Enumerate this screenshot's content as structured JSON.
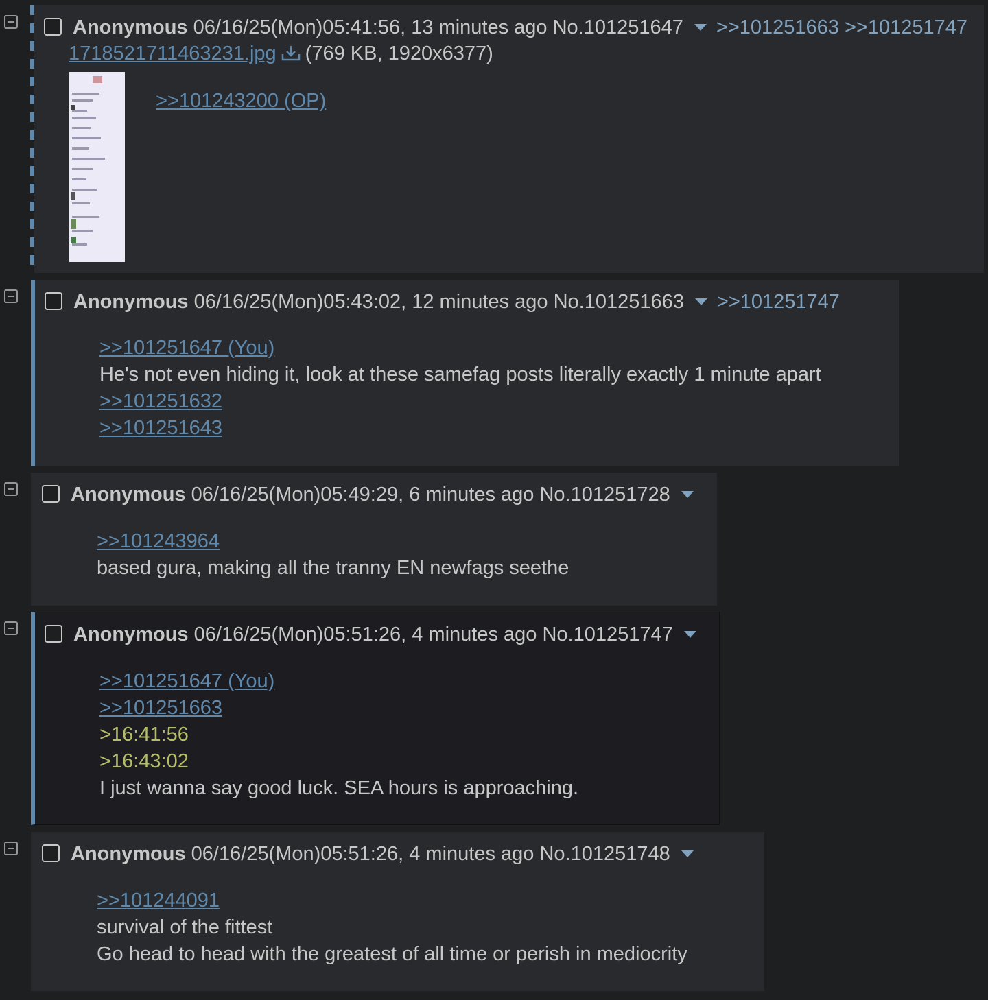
{
  "posts": [
    {
      "name": "Anonymous",
      "datetime": "06/16/25(Mon)05:41:56, 13 minutes ago",
      "no": "No.101251647",
      "backlinks": [
        ">>101251663",
        ">>101251747"
      ],
      "file": {
        "filename": "1718521711463231.jpg",
        "info": "(769 KB, 1920x6377)",
        "icon": "download-icon"
      },
      "body": [
        {
          "type": "quote",
          "text": ">>101243200 (OP)"
        }
      ]
    },
    {
      "name": "Anonymous",
      "datetime": "06/16/25(Mon)05:43:02, 12 minutes ago",
      "no": "No.101251663",
      "backlinks": [
        ">>101251747"
      ],
      "body": [
        {
          "type": "quote",
          "text": ">>101251647 (You)"
        },
        {
          "type": "text",
          "text": "He's not even hiding it, look at these samefag posts literally exactly 1 minute apart"
        },
        {
          "type": "quote",
          "text": ">>101251632"
        },
        {
          "type": "quote",
          "text": ">>101251643"
        }
      ]
    },
    {
      "name": "Anonymous",
      "datetime": "06/16/25(Mon)05:49:29, 6 minutes ago",
      "no": "No.101251728",
      "backlinks": [],
      "body": [
        {
          "type": "quote",
          "text": ">>101243964"
        },
        {
          "type": "text",
          "text": "based gura, making all the tranny EN newfags seethe"
        }
      ]
    },
    {
      "name": "Anonymous",
      "datetime": "06/16/25(Mon)05:51:26, 4 minutes ago",
      "no": "No.101251747",
      "backlinks": [],
      "body": [
        {
          "type": "quote",
          "text": ">>101251647 (You)"
        },
        {
          "type": "quote",
          "text": ">>101251663"
        },
        {
          "type": "green",
          "text": ">16:41:56"
        },
        {
          "type": "green",
          "text": ">16:43:02"
        },
        {
          "type": "text",
          "text": "I just wanna say good luck. SEA hours is approaching."
        }
      ]
    },
    {
      "name": "Anonymous",
      "datetime": "06/16/25(Mon)05:51:26, 4 minutes ago",
      "no": "No.101251748",
      "backlinks": [],
      "body": [
        {
          "type": "quote",
          "text": ">>101244091"
        },
        {
          "type": "text",
          "text": "survival of the fittest"
        },
        {
          "type": "text",
          "text": "Go head to head with the greatest of all time or perish in mediocrity"
        }
      ]
    }
  ],
  "colors": {
    "background": "#1d1f21",
    "post_bg": "#282a2e",
    "text": "#c5c8c6",
    "link": "#5f89ac",
    "backlink": "#81a2be",
    "greentext": "#b5bd68"
  }
}
